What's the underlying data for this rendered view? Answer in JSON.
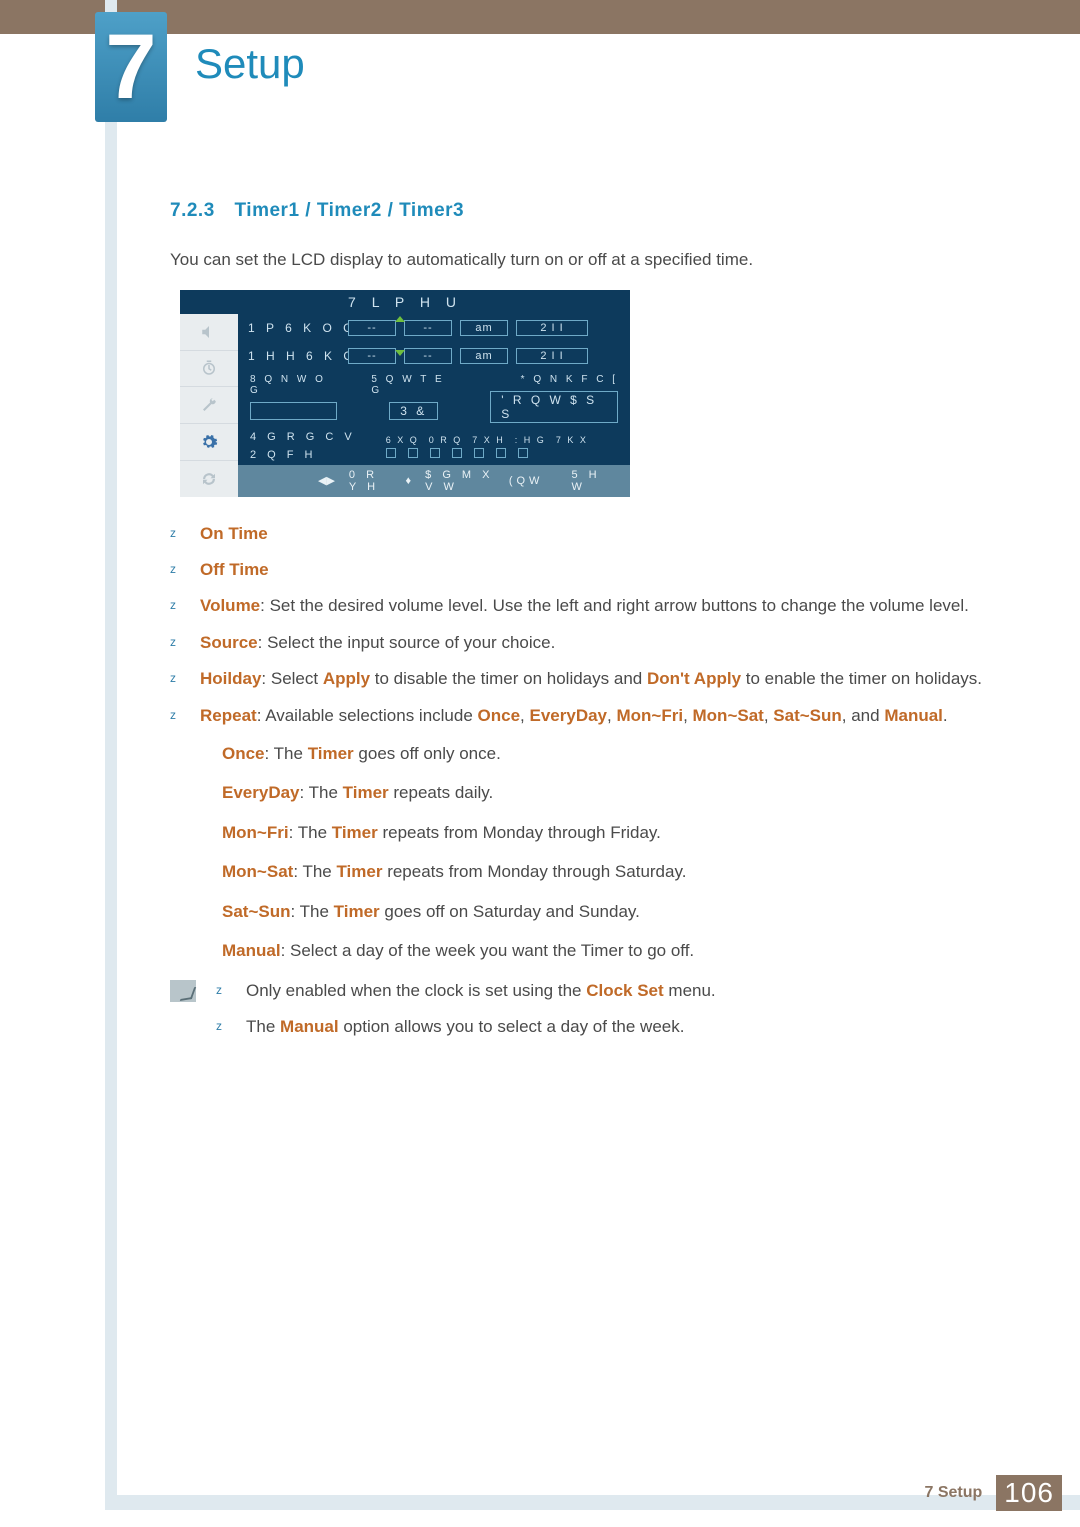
{
  "chapter": {
    "number": "7",
    "title": "Setup"
  },
  "section": {
    "number": "7.2.3",
    "title": "Timer1 / Timer2 / Timer3"
  },
  "intro": "You can set the LCD display to automatically turn on or off at a specified time.",
  "osd": {
    "title": "7 L P H U",
    "onTimeLabel": "1 P  6 K O G",
    "offTimeLabel": "1 H H  6 K O G",
    "dash": "--",
    "ampm": "am",
    "off": "2 I I",
    "volumeLabel": "8 Q N W O G",
    "sourceLabel": "5 Q W T E G",
    "holidayLabel": "* Q N K F C [",
    "pcLabel": "3 &",
    "dontApp": "' R Q  W  $ S S",
    "repeatLabel": "4 G R G C V",
    "onceLabel": "2 Q F H",
    "days": [
      "6 X Q",
      "0 R Q",
      "7 X H",
      ": H G",
      "7 K X"
    ],
    "footerMove": "0 R Y H",
    "footerAdjust": "$ G M X V W",
    "footerEnter": "(QW",
    "footerReturn": "5 H W"
  },
  "bullets": {
    "onTime": "On Time",
    "offTime": "Off Time",
    "volume": {
      "kw": "Volume",
      "text": ": Set the desired volume level. Use the left and right arrow buttons to change the volume level."
    },
    "source": {
      "kw": "Source",
      "text": ": Select the input source of your choice."
    },
    "holiday": {
      "kw": "Hoilday",
      "pre": ": Select ",
      "apply": "Apply",
      "mid": " to disable the timer on holidays and ",
      "dont": "Don't Apply",
      "post": " to enable the timer on holidays."
    },
    "repeat": {
      "kw": "Repeat",
      "pre": ": Available selections include ",
      "opts": [
        "Once",
        "EveryDay",
        "Mon~Fri",
        "Mon~Sat",
        "Sat~Sun"
      ],
      "and": ", and ",
      "last": "Manual",
      "tail": "."
    }
  },
  "subs": {
    "once": {
      "kw": "Once",
      "mid": ": The ",
      "timer": "Timer",
      "post": " goes off only once."
    },
    "every": {
      "kw": "EveryDay",
      "mid": ": The ",
      "timer": "Timer",
      "post": " repeats daily."
    },
    "monfri": {
      "kw": "Mon~Fri",
      "mid": ": The ",
      "timer": "Timer",
      "post": " repeats from Monday through Friday."
    },
    "monsat": {
      "kw": "Mon~Sat",
      "mid": ": The ",
      "timer": "Timer",
      "post": " repeats from Monday through Saturday."
    },
    "satsun": {
      "kw": "Sat~Sun",
      "mid": ": The ",
      "timer": "Timer",
      "post": " goes off on Saturday and Sunday."
    },
    "manual": {
      "kw": "Manual",
      "text": ": Select a day of the week you want the Timer to go off."
    }
  },
  "notes": {
    "n1": {
      "pre": "Only enabled when the clock is set using the ",
      "kw": "Clock Set",
      "post": " menu."
    },
    "n2": {
      "pre": "The ",
      "kw": "Manual",
      "post": " option allows you to select a day of the week."
    }
  },
  "footer": {
    "label": "7 Setup",
    "page": "106"
  }
}
